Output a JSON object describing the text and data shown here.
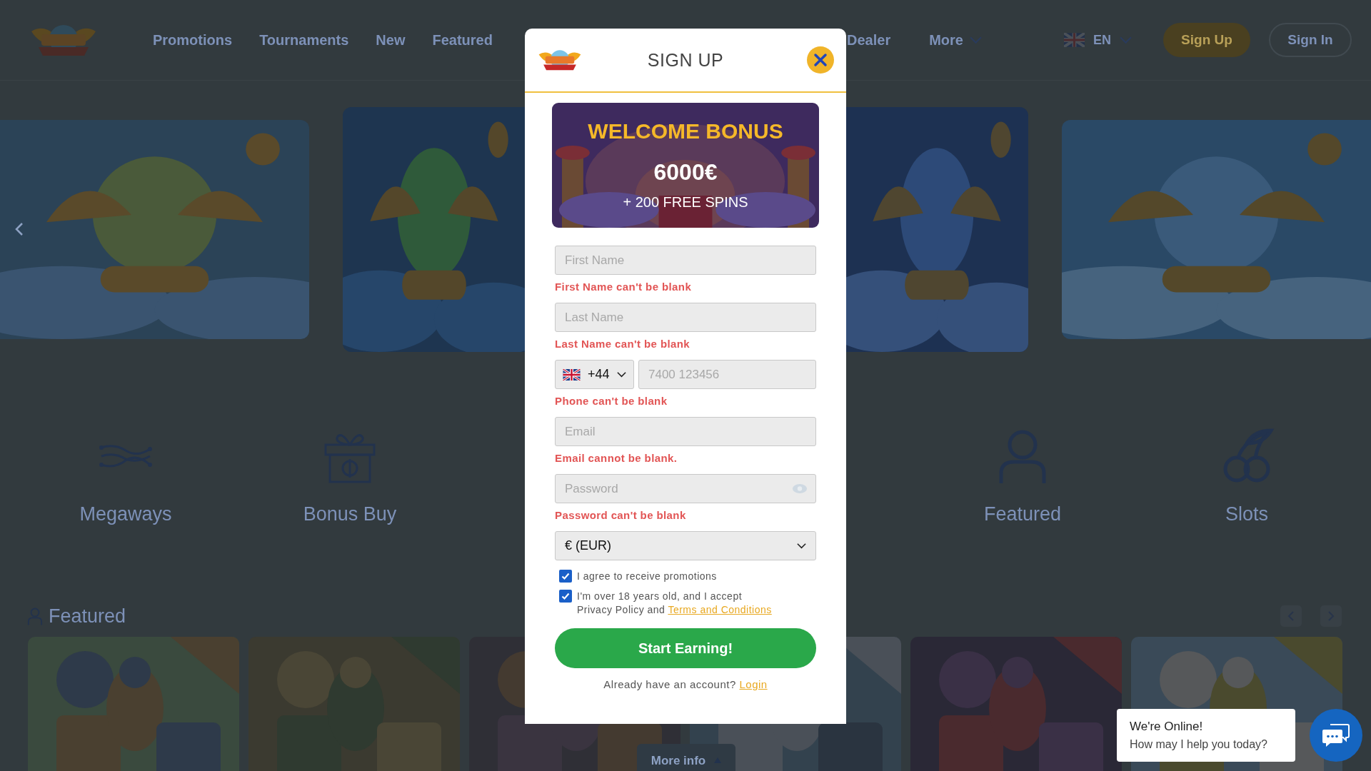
{
  "header": {
    "nav": [
      "Promotions",
      "Tournaments",
      "New",
      "Featured"
    ],
    "nav_right": [
      "Dealer"
    ],
    "more": "More",
    "language": "EN",
    "sign_up": "Sign Up",
    "sign_in": "Sign In"
  },
  "categories": [
    {
      "label": "Megaways",
      "kind": "waves"
    },
    {
      "label": "Bonus Buy",
      "kind": "gift"
    },
    {
      "label": "Featured",
      "kind": "person"
    },
    {
      "label": "Slots",
      "kind": "cherries"
    }
  ],
  "featured": {
    "title": "Featured",
    "more_info": "More info"
  },
  "modal": {
    "title": "SIGN UP",
    "bonus": {
      "title": "WELCOME BONUS",
      "amount": "6000€",
      "spins": "+ 200 FREE SPINS"
    },
    "fields": [
      {
        "kind": "text",
        "placeholder": "First Name",
        "error": "First Name can't be blank"
      },
      {
        "kind": "text",
        "placeholder": "Last Name",
        "error": "Last Name can't be blank"
      },
      {
        "kind": "phone",
        "country_code": "+44",
        "placeholder": "7400 123456",
        "error": "Phone can't be blank"
      },
      {
        "kind": "text",
        "placeholder": "Email",
        "error": "Email cannot be blank."
      },
      {
        "kind": "password",
        "placeholder": "Password",
        "error": "Password can't be blank"
      }
    ],
    "currency": {
      "value": "€ (EUR)"
    },
    "checkboxes": [
      {
        "lines": [
          "I agree to receive promotions"
        ],
        "checked": true
      },
      {
        "lines": [
          "I'm over 18 years old, and I accept",
          "Privacy Policy and"
        ],
        "link": "Terms and Conditions",
        "checked": true
      }
    ],
    "submit": "Start Earning!",
    "login_prompt": "Already have an account?",
    "login_link": "Login"
  },
  "chat": {
    "title": "We're Online!",
    "message": "How may I help you today?"
  }
}
